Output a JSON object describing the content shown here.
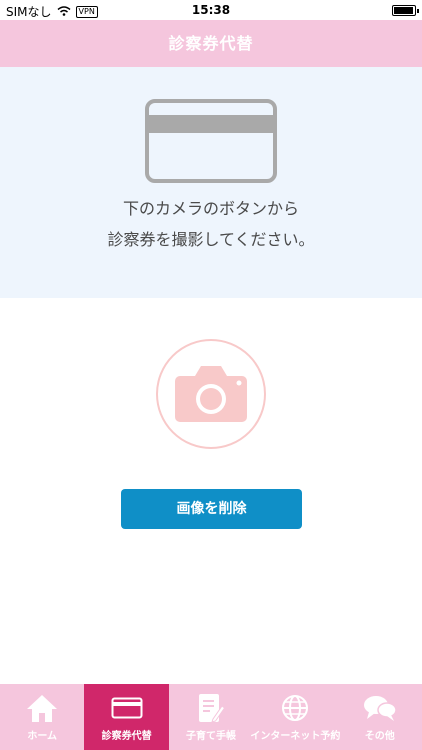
{
  "status_bar": {
    "carrier": "SIMなし",
    "vpn": "VPN",
    "time": "15:38"
  },
  "header": {
    "title": "診察券代替"
  },
  "info": {
    "line1": "下のカメラのボタンから",
    "line2": "診察券を撮影してください。"
  },
  "actions": {
    "delete_label": "画像を削除"
  },
  "tabs": [
    {
      "label": "ホーム",
      "icon": "home-icon",
      "active": false
    },
    {
      "label": "診察券代替",
      "icon": "card-icon",
      "active": true
    },
    {
      "label": "子育て手帳",
      "icon": "notebook-icon",
      "active": false
    },
    {
      "label": "インターネット予約",
      "icon": "globe-icon",
      "active": false
    },
    {
      "label": "その他",
      "icon": "chat-bubbles-icon",
      "active": false
    }
  ],
  "colors": {
    "header_pink": "#f5c6dd",
    "active_tab": "#d0276a",
    "button_blue": "#0f8fc7",
    "panel_bg": "#eef5fd",
    "camera_pink": "#f8c9c9"
  }
}
